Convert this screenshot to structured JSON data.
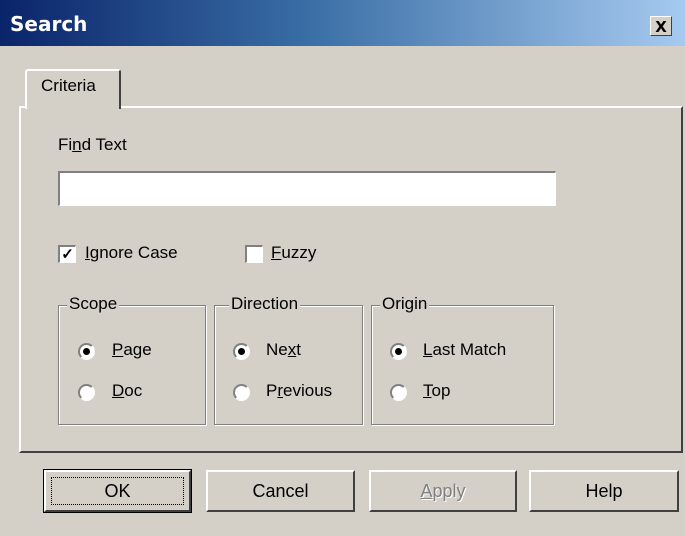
{
  "window": {
    "title": "Search",
    "close_glyph": "X"
  },
  "tab": {
    "label": "Criteria"
  },
  "find": {
    "label_pre": "Fi",
    "label_u": "n",
    "label_post": "d Text",
    "value": ""
  },
  "options": {
    "ignore_case": {
      "u": "I",
      "rest": "gnore Case",
      "checked": true,
      "mark": "✓"
    },
    "fuzzy": {
      "u": "F",
      "rest": "uzzy",
      "checked": false
    }
  },
  "scope": {
    "legend": "Scope",
    "page": {
      "u": "P",
      "rest": "age",
      "selected": true
    },
    "doc": {
      "u": "D",
      "rest": "oc",
      "selected": false
    }
  },
  "direction": {
    "legend": "Direction",
    "next": {
      "pre": "Ne",
      "u": "x",
      "rest": "t",
      "selected": true
    },
    "previous": {
      "pre": "P",
      "u": "r",
      "rest": "evious",
      "selected": false
    }
  },
  "origin": {
    "legend": "Origin",
    "last_match": {
      "u": "L",
      "rest": "ast Match",
      "selected": true
    },
    "top": {
      "u": "T",
      "rest": "op",
      "selected": false
    }
  },
  "buttons": {
    "ok": "OK",
    "cancel": "Cancel",
    "apply_u": "A",
    "apply_rest": "pply",
    "apply_enabled": false,
    "help": "Help"
  }
}
